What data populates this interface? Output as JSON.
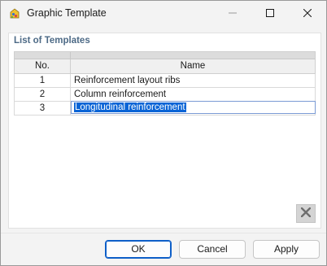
{
  "window": {
    "title": "Graphic Template"
  },
  "titlebar": {
    "minimize_icon": "minimize-icon",
    "maximize_icon": "maximize-icon",
    "close_icon": "close-icon"
  },
  "templates": {
    "section_title": "List of Templates",
    "columns": {
      "no": "No.",
      "name": "Name"
    },
    "rows": [
      {
        "no": "1",
        "name": "Reinforcement layout ribs"
      },
      {
        "no": "2",
        "name": "Column reinforcement"
      },
      {
        "no": "3",
        "name": "Longitudinal reinforcement"
      }
    ],
    "delete_icon": "delete-icon"
  },
  "buttons": {
    "ok": "OK",
    "cancel": "Cancel",
    "apply": "Apply"
  },
  "colors": {
    "accent": "#0e5fc8",
    "section_title": "#4d6a86",
    "selection": "#0a64d6"
  }
}
